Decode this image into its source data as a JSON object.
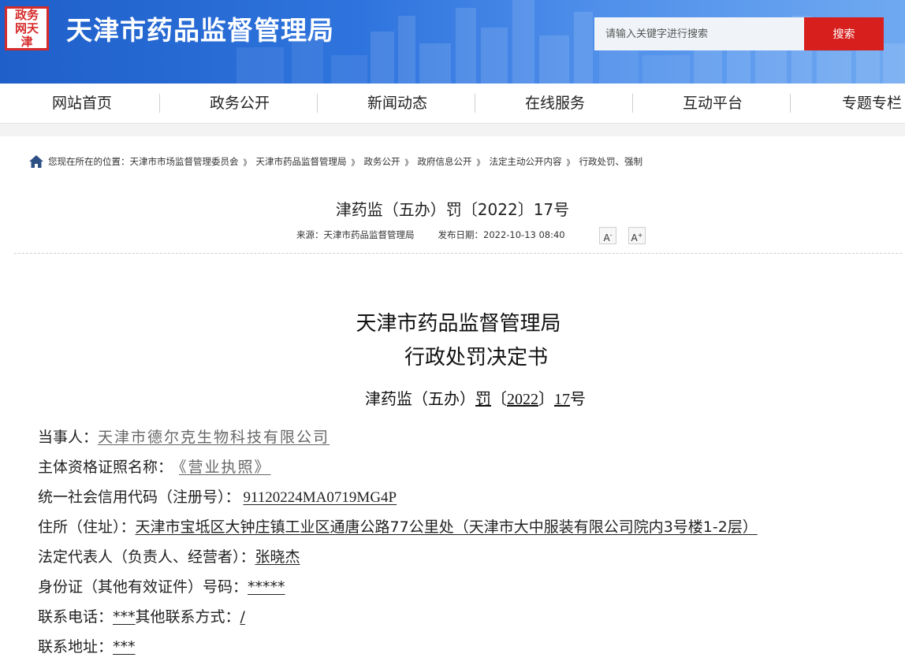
{
  "header": {
    "logo_text": "政务网天津",
    "site_title": "天津市药品监督管理局",
    "search_placeholder": "请输入关键字进行搜索",
    "search_button": "搜索"
  },
  "nav": {
    "items": [
      "网站首页",
      "政务公开",
      "新闻动态",
      "在线服务",
      "互动平台",
      "专题专栏"
    ]
  },
  "breadcrumb": {
    "prefix": "您现在所在的位置：",
    "items": [
      "天津市市场监督管理委员会",
      "天津市药品监督管理局",
      "政务公开",
      "政府信息公开",
      "法定主动公开内容",
      "行政处罚、强制"
    ],
    "separator": "》"
  },
  "article": {
    "doc_number": "津药监（五办）罚〔2022〕17号",
    "source": "来源：天津市药品监督管理局",
    "date": "发布日期：2022-10-13 08:40",
    "font_smaller": "A",
    "font_larger": "A",
    "title_line1": "天津市药品监督管理局",
    "title_line2": "行政处罚决定书",
    "sub_no_part1": "津药监（五办）",
    "sub_no_part2": "罚",
    "sub_no_part3": "〔",
    "sub_no_part4": "2022",
    "sub_no_part5": "〕",
    "sub_no_part6": "17",
    "sub_no_part7": "号"
  },
  "fields": [
    {
      "label": "当事人：",
      "value": "天津市德尔克生物科技有限公司"
    },
    {
      "label": "主体资格证照名称：",
      "value": "《营业执照》"
    },
    {
      "label": "统一社会信用代码（注册号）：",
      "value": "91120224MA0719MG4P"
    },
    {
      "label": "住所（住址）：",
      "value": "天津市宝坻区大钟庄镇工业区通唐公路77公里处（天津市大中服装有限公司院内3号楼1-2层）"
    },
    {
      "label": "法定代表人（负责人、经营者）：",
      "value": "张晓杰"
    },
    {
      "label": "身份证（其他有效证件）号码：",
      "value": "*****"
    },
    {
      "label": "联系电话：",
      "value": "***",
      "extra_label": "其他联系方式：",
      "extra_value": "/"
    },
    {
      "label": "联系地址：",
      "value": "***"
    }
  ]
}
